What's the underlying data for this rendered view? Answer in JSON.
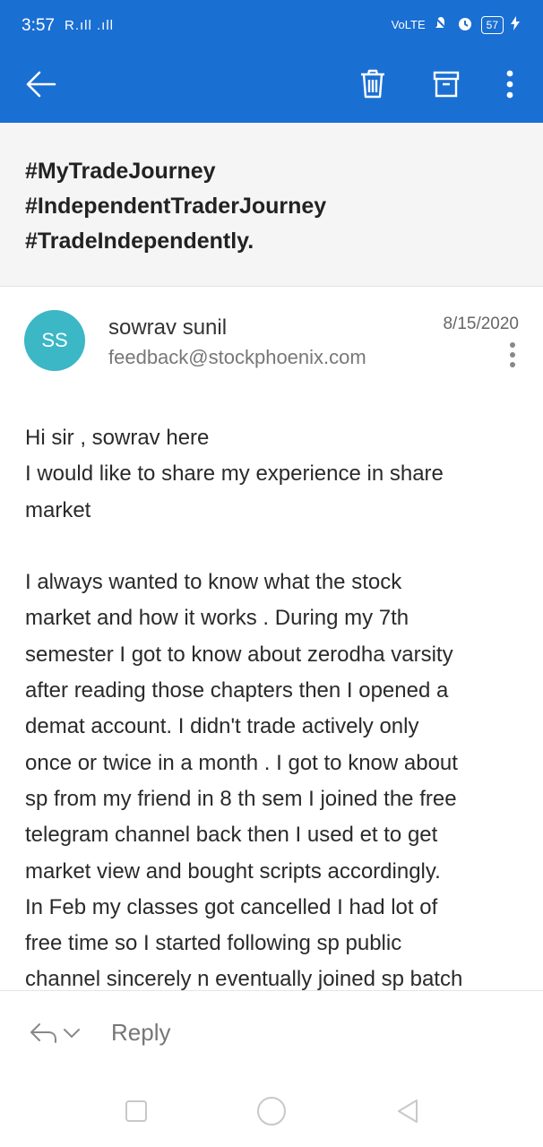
{
  "status_bar": {
    "time": "3:57",
    "signal": "R.ıll .ıll",
    "network": "VoLTE",
    "battery": "57"
  },
  "app_bar": {
    "back_icon": "arrow-left-icon",
    "delete_icon": "trash-icon",
    "archive_icon": "archive-icon",
    "more_icon": "more-vertical-icon",
    "color": "#1a6fd3"
  },
  "subject": {
    "lines": [
      "#MyTradeJourney",
      "#IndependentTraderJourney",
      "#TradeIndependently."
    ]
  },
  "sender": {
    "initials": "SS",
    "name": "sowrav sunil",
    "email": "feedback@stockphoenix.com",
    "date": "8/15/2020",
    "avatar_color": "#3bb7c6"
  },
  "message": {
    "paragraph1": [
      "Hi sir , sowrav here",
      "I would like to share my experience in share",
      "market"
    ],
    "paragraph2": [
      "I always wanted to know what the stock",
      "market and how it works . During my 7th",
      "semester I got to know about zerodha varsity",
      "after reading those chapters then I opened a",
      "demat account. I didn't trade actively only",
      "once or twice in a month . I got to know about",
      "sp from my friend in 8 th sem I joined the free",
      "telegram channel back then I used et to get",
      "market view and bought scripts accordingly.",
      "In Feb my classes got cancelled I had lot of",
      "free time so I started following sp public",
      "channel sincerely n eventually joined sp batch"
    ]
  },
  "reply_bar": {
    "label": "Reply"
  }
}
